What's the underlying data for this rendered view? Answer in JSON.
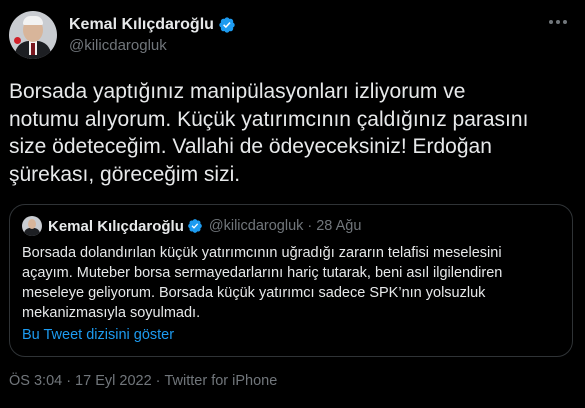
{
  "author": {
    "display_name": "Kemal Kılıçdaroğlu",
    "handle": "@kilicdarogluk",
    "verified": true
  },
  "tweet": {
    "text": "Borsada yaptığınız manipülasyonları izliyorum ve\nnotumu alıyorum. Küçük yatırımcının çaldığınız parasını\nsize ödeteceğim. Vallahi de ödeyeceksiniz! Erdoğan\nşürekası, göreceğim sizi."
  },
  "quoted_tweet": {
    "display_name": "Kemal Kılıçdaroğlu",
    "handle": "@kilicdarogluk",
    "separator": "·",
    "date": "28 Ağu",
    "text": "Borsada dolandırılan küçük yatırımcının uğradığı zararın telafisi meselesini\naçayım. Muteber borsa sermayedarlarını hariç tutarak, beni asıl ilgilendiren\nmeseleye geliyorum. Borsada küçük yatırımcı sadece SPK’nın yolsuzluk\nmekanizmasıyla soyulmadı.",
    "thread_link": "Bu Tweet dizisini göster"
  },
  "meta": {
    "time": "ÖS 3:04",
    "separator": "·",
    "date": "17 Eyl 2022",
    "source": "Twitter for iPhone"
  },
  "icons": {
    "verified": "verified-badge-icon",
    "more": "more-options-icon"
  },
  "colors": {
    "background": "#000000",
    "text": "#e7e9ea",
    "secondary": "#71767b",
    "link": "#1d9bf0",
    "border": "#2f3336",
    "verified": "#1d9bf0"
  }
}
